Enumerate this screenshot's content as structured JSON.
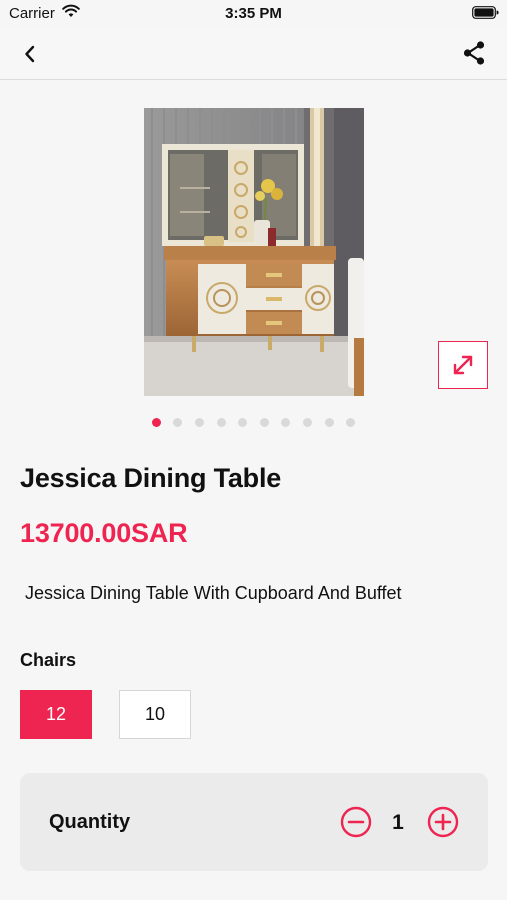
{
  "status_bar": {
    "carrier": "Carrier",
    "time": "3:35 PM"
  },
  "nav": {
    "back_icon": "chevron-left-icon",
    "share_icon": "share-icon"
  },
  "gallery": {
    "image_alt": "Jessica Dining Table with cupboard and buffet",
    "expand_icon": "expand-arrows-icon",
    "dot_count": 10,
    "active_index": 0
  },
  "product": {
    "title": "Jessica Dining Table",
    "price": "13700.00SAR",
    "description": "Jessica Dining Table With Cupboard And Buffet"
  },
  "chairs": {
    "label": "Chairs",
    "options": [
      "12",
      "10"
    ],
    "selected": "12"
  },
  "quantity": {
    "label": "Quantity",
    "value": "1",
    "minus_icon": "minus-circle-icon",
    "plus_icon": "plus-circle-icon"
  },
  "colors": {
    "accent": "#ee2451",
    "background": "#f6f6f6",
    "card": "#ebebeb"
  }
}
